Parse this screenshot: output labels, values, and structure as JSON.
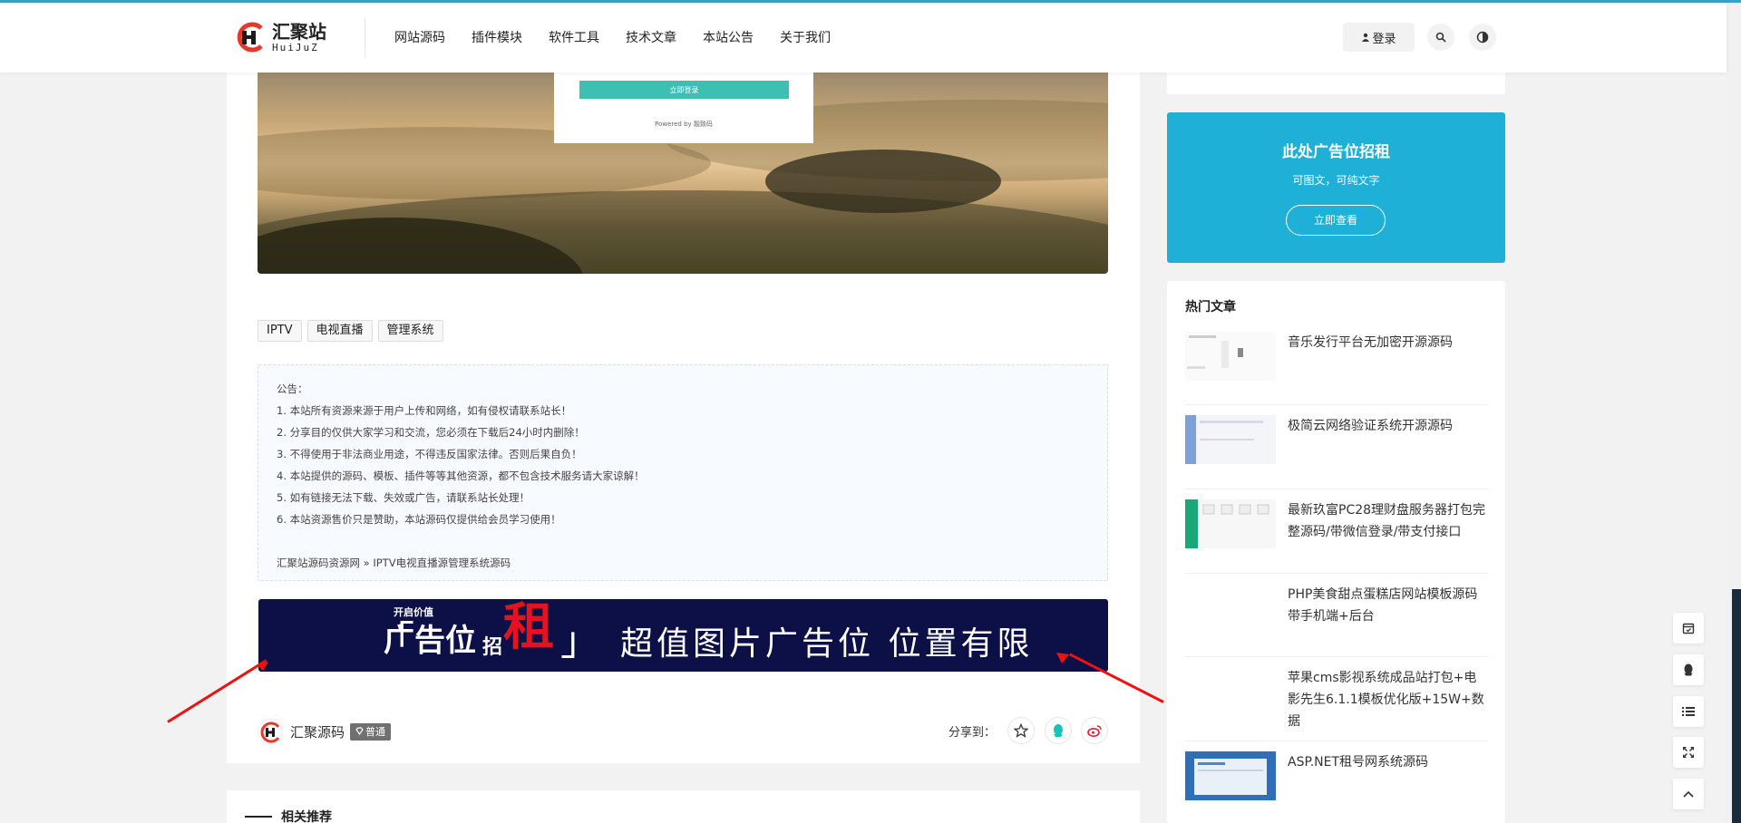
{
  "header": {
    "logo_cn": "汇聚站",
    "logo_en": "HuiJuZ",
    "nav": [
      "网站源码",
      "插件模块",
      "软件工具",
      "技术文章",
      "本站公告",
      "关于我们"
    ],
    "login_label": "登录"
  },
  "banner": {
    "login_button": "立即登录",
    "powered": "Powered by 靓致码"
  },
  "tags": [
    "IPTV",
    "电视直播",
    "管理系统"
  ],
  "notice": {
    "lines": [
      "公告：",
      "1. 本站所有资源来源于用户上传和网络，如有侵权请联系站长！",
      "2. 分享目的仅供大家学习和交流，您必须在下载后24小时内删除！",
      "3. 不得使用于非法商业用途，不得违反国家法律。否则后果自负！",
      "4. 本站提供的源码、模板、插件等等其他资源，都不包含技术服务请大家谅解！",
      "5. 如有链接无法下载、失效或广告，请联系站长处理！",
      "6. 本站资源售价只是赞助，本站源码仅提供给会员学习使用！"
    ],
    "breadcrumb": "汇聚站源码资源网 » IPTV电视直播源管理系统源码"
  },
  "ad_banner": {
    "small": "开启价值",
    "left_a": "广告位",
    "left_b": "招",
    "big": "租",
    "right": "超值图片广告位 位置有限"
  },
  "author": {
    "name": "汇聚源码",
    "badge": "普通",
    "share_label": "分享到："
  },
  "related_title": "相关推荐",
  "side_ad": {
    "title": "此处广告位招租",
    "sub": "可图文，可纯文字",
    "button": "立即查看"
  },
  "hot": {
    "title": "热门文章",
    "items": [
      "音乐发行平台无加密开源源码",
      "极简云网络验证系统开源源码",
      "最新玖富PC28理财盘服务器打包完整源码/带微信登录/带支付接口",
      "PHP美食甜点蛋糕店网站模板源码 带手机端+后台",
      "苹果cms影视系统成品站打包+电影先生6.1.1模板优化版+15W+数据",
      "ASP.NET租号网系统源码"
    ]
  },
  "colors": {
    "accent": "#1fb0d7",
    "ad_bg": "#0c1046",
    "ad_red": "#e8121f",
    "login_teal": "#3cc0b2"
  }
}
